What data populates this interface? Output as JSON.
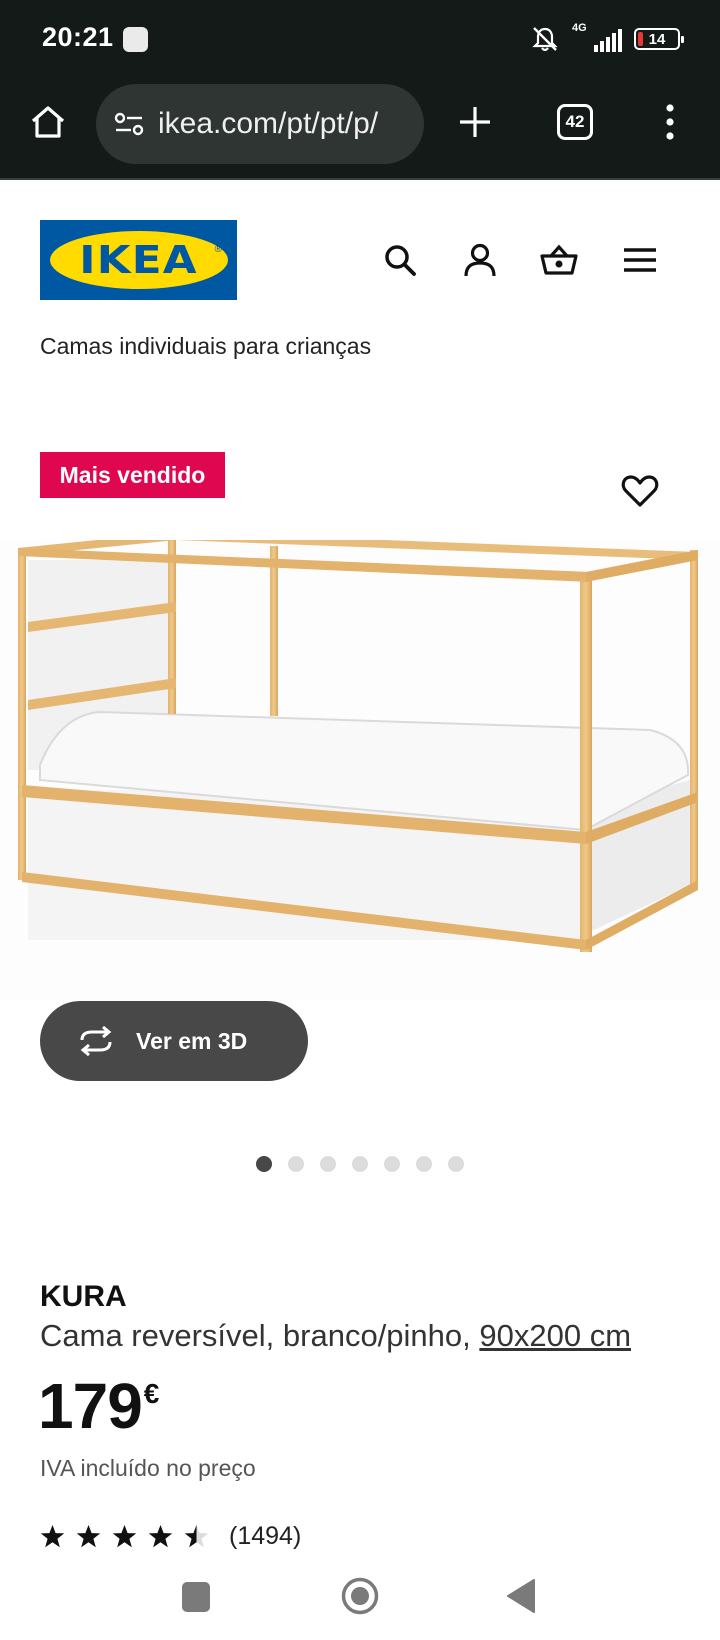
{
  "status_bar": {
    "time": "20:21",
    "network": "4G",
    "battery": "14"
  },
  "browser": {
    "url": "ikea.com/pt/pt/p/",
    "tab_count": "42"
  },
  "header": {
    "logo_text": "IKEA",
    "icons": [
      "search-icon",
      "account-icon",
      "basket-icon",
      "menu-icon"
    ]
  },
  "breadcrumb": "Camas individuais para crianças",
  "badge": "Mais vendido",
  "view_3d_label": "Ver em 3D",
  "carousel": {
    "total": 7,
    "active": 1
  },
  "product": {
    "name": "KURA",
    "description": "Cama reversível, branco/pinho, ",
    "size_link": "90x200 cm",
    "price": "179",
    "currency": "€",
    "vat_note": "IVA incluído no preço",
    "rating_value": 4.5,
    "rating_count": "(1494)"
  },
  "colors": {
    "ikea_blue": "#0058a3",
    "ikea_yellow": "#ffdb00",
    "badge_red": "#e00751",
    "button_dark": "#484848"
  }
}
